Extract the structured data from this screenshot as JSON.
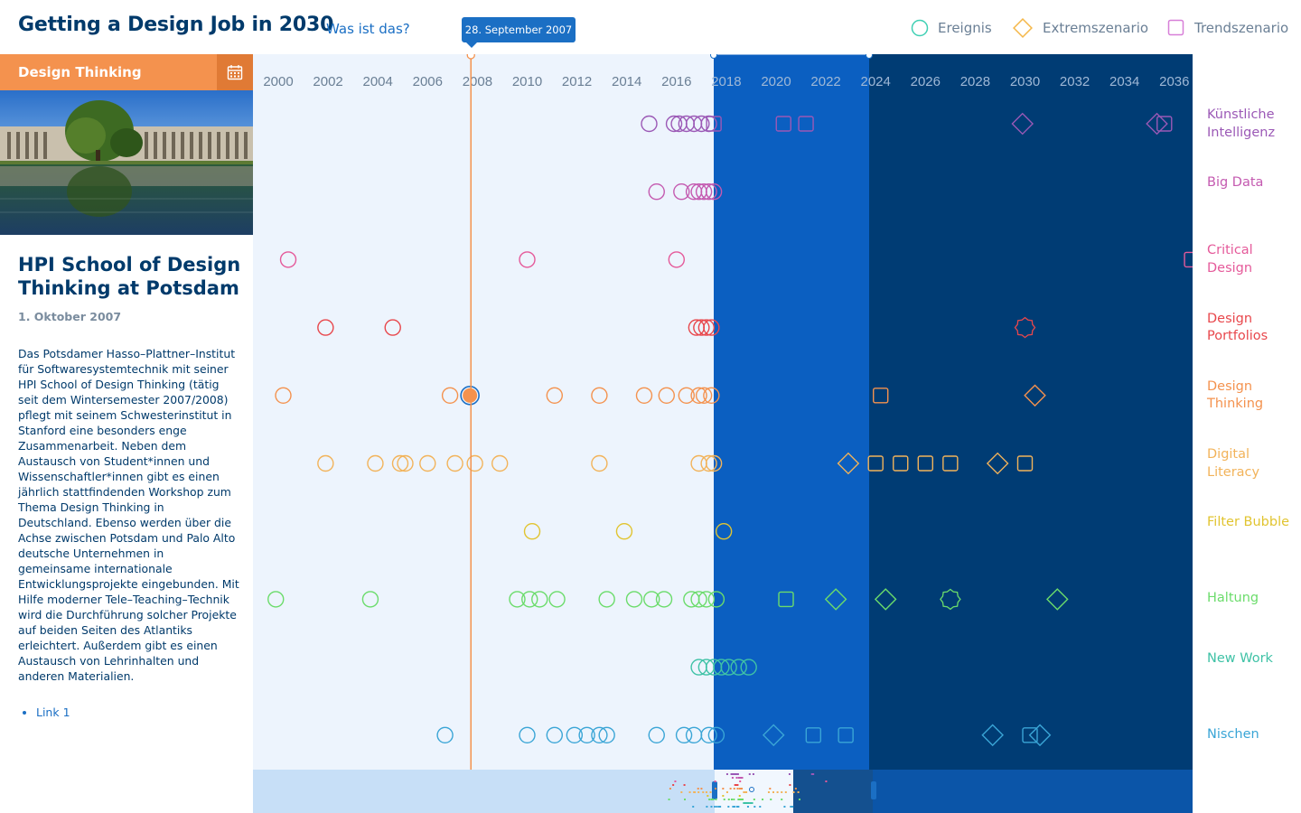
{
  "header": {
    "title": "Getting a Design Job in 2030",
    "help_link": "Was ist das?"
  },
  "legend": [
    {
      "label": "Ereignis",
      "shape": "circle",
      "color": "#3fd0b4"
    },
    {
      "label": "Extremszenario",
      "shape": "diamond",
      "color": "#f5b84a"
    },
    {
      "label": "Trendszenario",
      "shape": "square",
      "color": "#d77fd8"
    }
  ],
  "selected_date": "28. September 2007",
  "years": [
    "2000",
    "2002",
    "2004",
    "2006",
    "2008",
    "2010",
    "2012",
    "2014",
    "2016",
    "2018",
    "2020",
    "2022",
    "2024",
    "2026",
    "2028",
    "2030",
    "2032",
    "2034",
    "2036"
  ],
  "panel": {
    "category": "Design Thinking",
    "calendar_icon": "calendar-icon",
    "title": "HPI School of Design Thinking at Potsdam",
    "date": "1. Oktober 2007",
    "description": "Das Potsdamer Hasso–Plattner–Institut für Softwaresystemtechnik mit seiner HPI School of Design Thinking (tätig seit dem Wintersemester 2007/2008) pflegt mit seinem Schwesterinstitut in Stanford eine besonders enge Zusammenarbeit. Neben dem Austausch von Student*innen und Wissenschaftler*innen gibt es einen jährlich stattfindenden Workshop zum Thema Design Thinking in Deutschland. Ebenso werden über die Achse zwischen Potsdam und Palo Alto deutsche Unternehmen in gemeinsame internationale Entwicklungsprojekte eingebunden. Mit Hilfe moderner Tele–Teaching–Technik wird die Durchführung solcher Projekte auf beiden Seiten des Atlantiks erleichtert. Außerdem gibt es einen Austausch von Lehrinhalten und anderen Materialien.",
    "links": [
      "Link 1"
    ]
  },
  "categories": [
    {
      "label": "Künstliche Intelligenz",
      "color": "#9b59b6",
      "events": [
        2014.9,
        2015.9,
        2016.1,
        2016.4,
        2016.7,
        2017.0,
        2017.3
      ],
      "trends": [
        2017.5,
        2020.3,
        2021.2,
        2035.6
      ],
      "extremes": [
        2029.9,
        2035.3
      ]
    },
    {
      "label": "Big Data",
      "color": "#c45ab0",
      "events": [
        2015.2,
        2016.2,
        2016.7,
        2016.9,
        2017.1,
        2017.3,
        2017.5
      ],
      "trends": [],
      "extremes": []
    },
    {
      "label": "Critical Design",
      "color": "#e55a9a",
      "events": [
        2000.4,
        2010.0,
        2016.0
      ],
      "trends": [
        2036.7
      ],
      "extremes": []
    },
    {
      "label": "Design Portfolios",
      "color": "#e8474c",
      "events": [
        2001.9,
        2004.6,
        2016.8,
        2017.0,
        2017.2,
        2017.4
      ],
      "trends": [],
      "extremes": [],
      "stars": [
        2030.0
      ]
    },
    {
      "label": "Design Thinking",
      "color": "#f4924e",
      "events": [
        2000.2,
        2006.9,
        2011.1,
        2012.9,
        2014.7,
        2015.6,
        2016.4,
        2016.9,
        2017.1,
        2017.4
      ],
      "highlight": [
        2007.7
      ],
      "trends": [
        2024.2
      ],
      "extremes": [
        2030.4
      ]
    },
    {
      "label": "Digital Literacy",
      "color": "#f2b35a",
      "events": [
        2001.9,
        2003.9,
        2004.9,
        2005.1,
        2006.0,
        2007.1,
        2007.9,
        2008.9,
        2012.9,
        2016.9,
        2017.3,
        2017.5
      ],
      "trends": [
        2024.0,
        2025.0,
        2026.0,
        2027.0,
        2030.0
      ],
      "extremes": [
        2022.9,
        2028.9
      ]
    },
    {
      "label": "Filter Bubble",
      "color": "#e1c430",
      "events": [
        2010.2,
        2013.9,
        2017.9
      ],
      "trends": [],
      "extremes": []
    },
    {
      "label": "Haltung",
      "color": "#6bdc6b",
      "events": [
        1999.9,
        2003.7,
        2009.6,
        2010.1,
        2010.5,
        2011.2,
        2013.2,
        2014.3,
        2015.0,
        2015.5,
        2016.6,
        2016.9,
        2017.2,
        2017.6
      ],
      "trends": [
        2020.4
      ],
      "extremes": [
        2022.4,
        2024.4,
        2031.3
      ],
      "stars": [
        2027.0
      ]
    },
    {
      "label": "New Work",
      "color": "#3fc2a6",
      "events": [
        2016.9,
        2017.2,
        2017.5,
        2017.8,
        2018.1,
        2018.5,
        2018.9
      ],
      "trends": [],
      "extremes": []
    },
    {
      "label": "Nischen",
      "color": "#3aa5d6",
      "events": [
        2006.7,
        2010.0,
        2011.1,
        2011.9,
        2012.4,
        2012.9,
        2013.2,
        2015.2,
        2016.3,
        2016.7,
        2017.3,
        2017.6
      ],
      "trends": [
        2021.5,
        2022.8,
        2030.2
      ],
      "extremes": [
        2019.9,
        2028.7,
        2030.6
      ]
    }
  ]
}
